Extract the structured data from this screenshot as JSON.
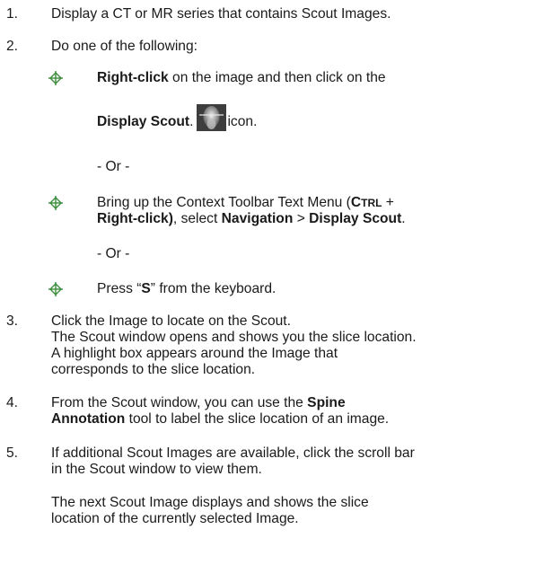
{
  "steps": [
    {
      "num": "1.",
      "text": "Display a CT or MR series that contains Scout Images."
    },
    {
      "num": "2.",
      "text": "Do one of the following:"
    },
    {
      "num": "3.",
      "lines": [
        "Click the Image to locate on the Scout.",
        "The Scout window opens and shows you the slice location.",
        "A highlight box appears around the Image that",
        "corresponds to the slice location."
      ]
    },
    {
      "num": "4.",
      "line1_a": "From the Scout window, you can use the ",
      "line1_b": "Spine",
      "line2_a": "Annotation",
      "line2_b": " tool to label the slice location of an image."
    },
    {
      "num": "5.",
      "lines": [
        "If additional Scout Images are available, click the scroll bar",
        "in the Scout window to view them."
      ],
      "para_lines": [
        "The next Scout Image displays and shows the slice",
        "location of the currently selected Image."
      ]
    }
  ],
  "options": [
    {
      "line1_bold": "Right-click",
      "line1_rest": " on the image and then click on the",
      "line2_bold": "Display Scout",
      "line2_rest": ".",
      "icon": "display-scout-icon",
      "line2_after": "icon."
    },
    {
      "line1_a": "Bring up the Context Toolbar Text Menu (",
      "ctrl_big": "C",
      "ctrl_small": "TRL",
      "line1_b": " +",
      "line2_bold": "Right-click)",
      "line2_a": ", select ",
      "line2_nav": "Navigation",
      "line2_gt": " > ",
      "line2_ds": "Display Scout",
      "line2_end": "."
    },
    {
      "a": "Press “",
      "b": "S",
      "c": "” from the keyboard."
    }
  ],
  "or_text": "- Or -",
  "colors": {
    "bullet": "#3a8c3a",
    "text": "#1a1a1a"
  }
}
